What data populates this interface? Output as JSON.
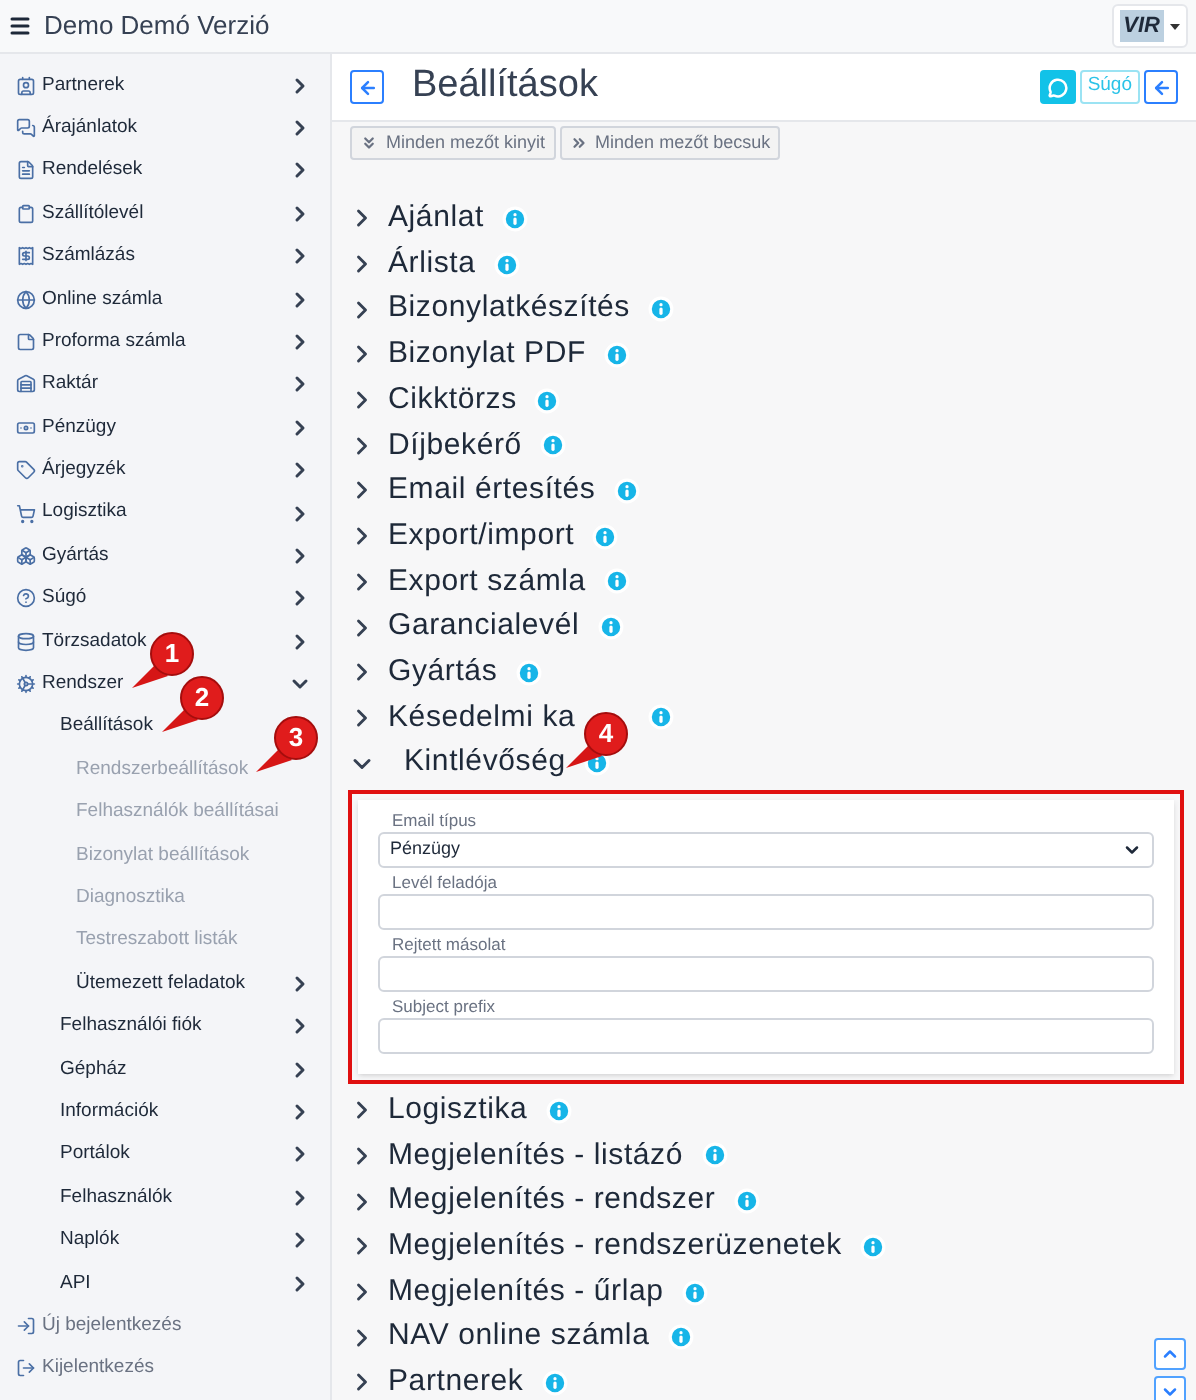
{
  "app_title": "Demo Demó Verzió",
  "logo": {
    "text": "VIR"
  },
  "sidebar": {
    "items": [
      {
        "label": "Partnerek",
        "expanded": false
      },
      {
        "label": "Árajánlatok",
        "expanded": false
      },
      {
        "label": "Rendelések",
        "expanded": false
      },
      {
        "label": "Szállítólevél",
        "expanded": false
      },
      {
        "label": "Számlázás",
        "expanded": false
      },
      {
        "label": "Online számla",
        "expanded": false
      },
      {
        "label": "Proforma számla",
        "expanded": false
      },
      {
        "label": "Raktár",
        "expanded": false
      },
      {
        "label": "Pénzügy",
        "expanded": false
      },
      {
        "label": "Árjegyzék",
        "expanded": false
      },
      {
        "label": "Logisztika",
        "expanded": false
      },
      {
        "label": "Gyártás",
        "expanded": false
      },
      {
        "label": "Súgó",
        "expanded": false
      },
      {
        "label": "Törzsadatok",
        "expanded": false
      },
      {
        "label": "Rendszer",
        "expanded": true,
        "children": [
          {
            "label": "Beállítások",
            "children": [
              {
                "label": "Rendszerbeállítások"
              },
              {
                "label": "Felhasználók beállításai"
              },
              {
                "label": "Bizonylat beállítások"
              },
              {
                "label": "Diagnosztika"
              },
              {
                "label": "Testreszabott listák"
              },
              {
                "label": "Ütemezett feladatok",
                "expanded": false
              }
            ]
          },
          {
            "label": "Felhasználói fiók",
            "expanded": false
          },
          {
            "label": "Gépház",
            "expanded": false
          },
          {
            "label": "Információk",
            "expanded": false
          },
          {
            "label": "Portálok",
            "expanded": false
          },
          {
            "label": "Felhasználók",
            "expanded": false
          },
          {
            "label": "Naplók",
            "expanded": false
          },
          {
            "label": "API",
            "expanded": false
          }
        ]
      }
    ],
    "footer_links": [
      {
        "label": "Új bejelentkezés"
      },
      {
        "label": "Kijelentkezés"
      }
    ]
  },
  "page": {
    "title": "Beállítások",
    "help_button": "Súgó",
    "toolbar": [
      {
        "label": "Minden mezőt kinyit",
        "kind": "expand"
      },
      {
        "label": "Minden mezőt becsuk",
        "kind": "collapse"
      }
    ],
    "sections": [
      {
        "title": "Ajánlat",
        "expanded": false
      },
      {
        "title": "Árlista",
        "expanded": false
      },
      {
        "title": "Bizonylatkészítés",
        "expanded": false
      },
      {
        "title": "Bizonylat PDF",
        "expanded": false
      },
      {
        "title": "Cikktörzs",
        "expanded": false
      },
      {
        "title": "Díjbekérő",
        "expanded": false
      },
      {
        "title": "Email értesítés",
        "expanded": false
      },
      {
        "title": "Export/import",
        "expanded": false
      },
      {
        "title": "Export számla",
        "expanded": false
      },
      {
        "title": "Garancialevél",
        "expanded": false
      },
      {
        "title": "Gyártás",
        "expanded": false
      },
      {
        "title": "Késedelmi ka",
        "expanded": false
      },
      {
        "title": "Kintlévőség",
        "expanded": true,
        "fields": [
          {
            "label": "Email típus",
            "kind": "select",
            "value": "Pénzügy"
          },
          {
            "label": "Levél feladója",
            "kind": "text"
          },
          {
            "label": "Rejtett másolat",
            "kind": "text"
          },
          {
            "label": "Subject prefix",
            "kind": "text"
          }
        ]
      },
      {
        "title": "Logisztika",
        "expanded": false
      },
      {
        "title": "Megjelenítés - listázó",
        "expanded": false
      },
      {
        "title": "Megjelenítés - rendszer",
        "expanded": false
      },
      {
        "title": "Megjelenítés - rendszerüzenetek",
        "expanded": false
      },
      {
        "title": "Megjelenítés - űrlap",
        "expanded": false
      },
      {
        "title": "NAV online számla",
        "expanded": false
      },
      {
        "title": "Partnerek",
        "expanded": false
      }
    ]
  },
  "annotations": [
    {
      "number": "1"
    },
    {
      "number": "2"
    },
    {
      "number": "3"
    },
    {
      "number": "4"
    }
  ]
}
